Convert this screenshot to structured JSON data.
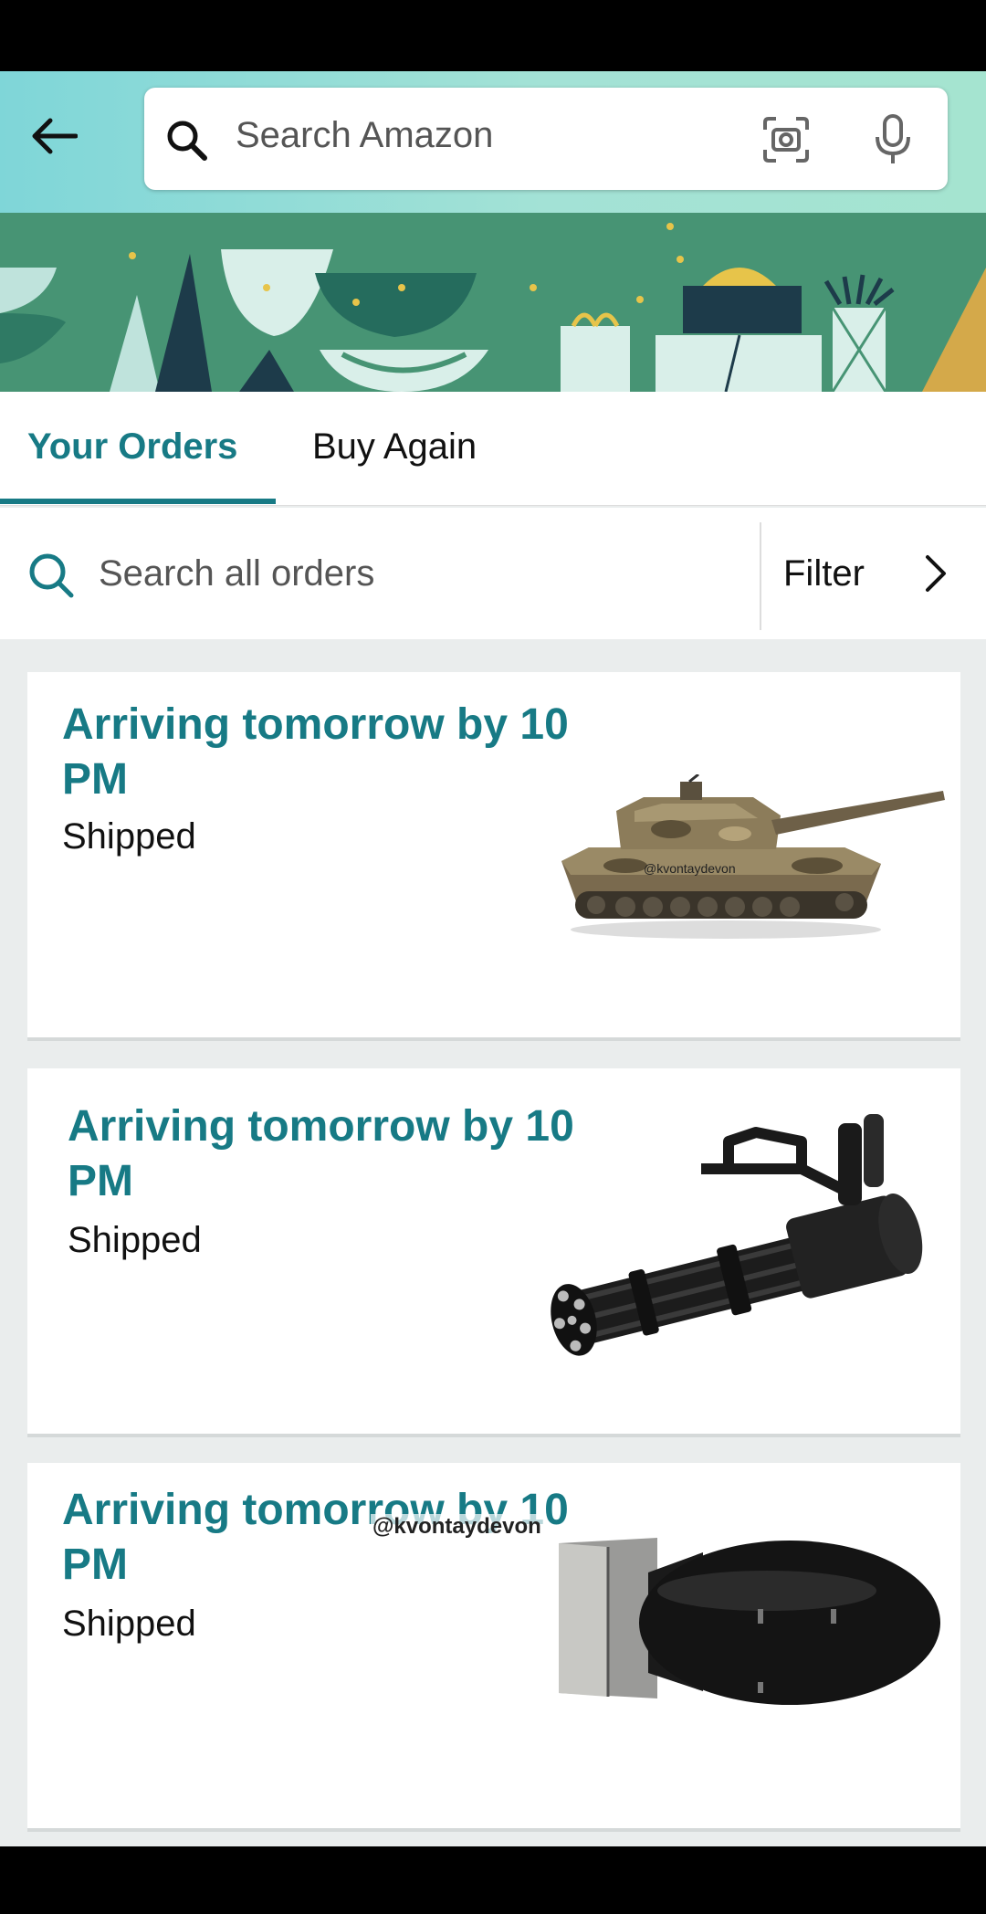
{
  "header": {
    "search_placeholder": "Search Amazon"
  },
  "tabs": [
    {
      "label": "Your Orders",
      "active": true
    },
    {
      "label": "Buy Again",
      "active": false
    }
  ],
  "order_search": {
    "placeholder": "Search all orders",
    "filter_label": "Filter"
  },
  "orders": [
    {
      "status": "Arriving tomorrow by 10 PM",
      "shipping": "Shipped",
      "image": "tank",
      "watermark": "@kvontaydevon"
    },
    {
      "status": "Arriving tomorrow by 10 PM",
      "shipping": "Shipped",
      "image": "minigun"
    },
    {
      "status": "Arriving tomorrow by 10 PM",
      "shipping": "Shipped",
      "image": "bomb",
      "watermark": "@kvontaydevon"
    }
  ],
  "colors": {
    "accent": "#177a85",
    "header_gradient_start": "#7fd6d8",
    "header_gradient_end": "#a5e4d0",
    "banner": "#479474"
  }
}
